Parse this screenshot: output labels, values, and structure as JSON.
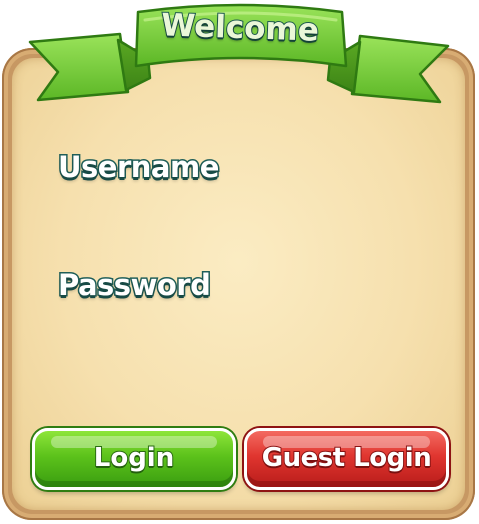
{
  "header": {
    "title": "Welcome",
    "ribbon_color": "#7dcf3f"
  },
  "form": {
    "username_label": "Username",
    "username_value": "",
    "password_label": "Password",
    "password_value": ""
  },
  "buttons": {
    "login_label": "Login",
    "login_color": "#5cc21b",
    "guest_label": "Guest Login",
    "guest_color": "#e0352f"
  },
  "panel": {
    "parchment_color": "#f6e0ae",
    "frame_color": "#c79863"
  }
}
